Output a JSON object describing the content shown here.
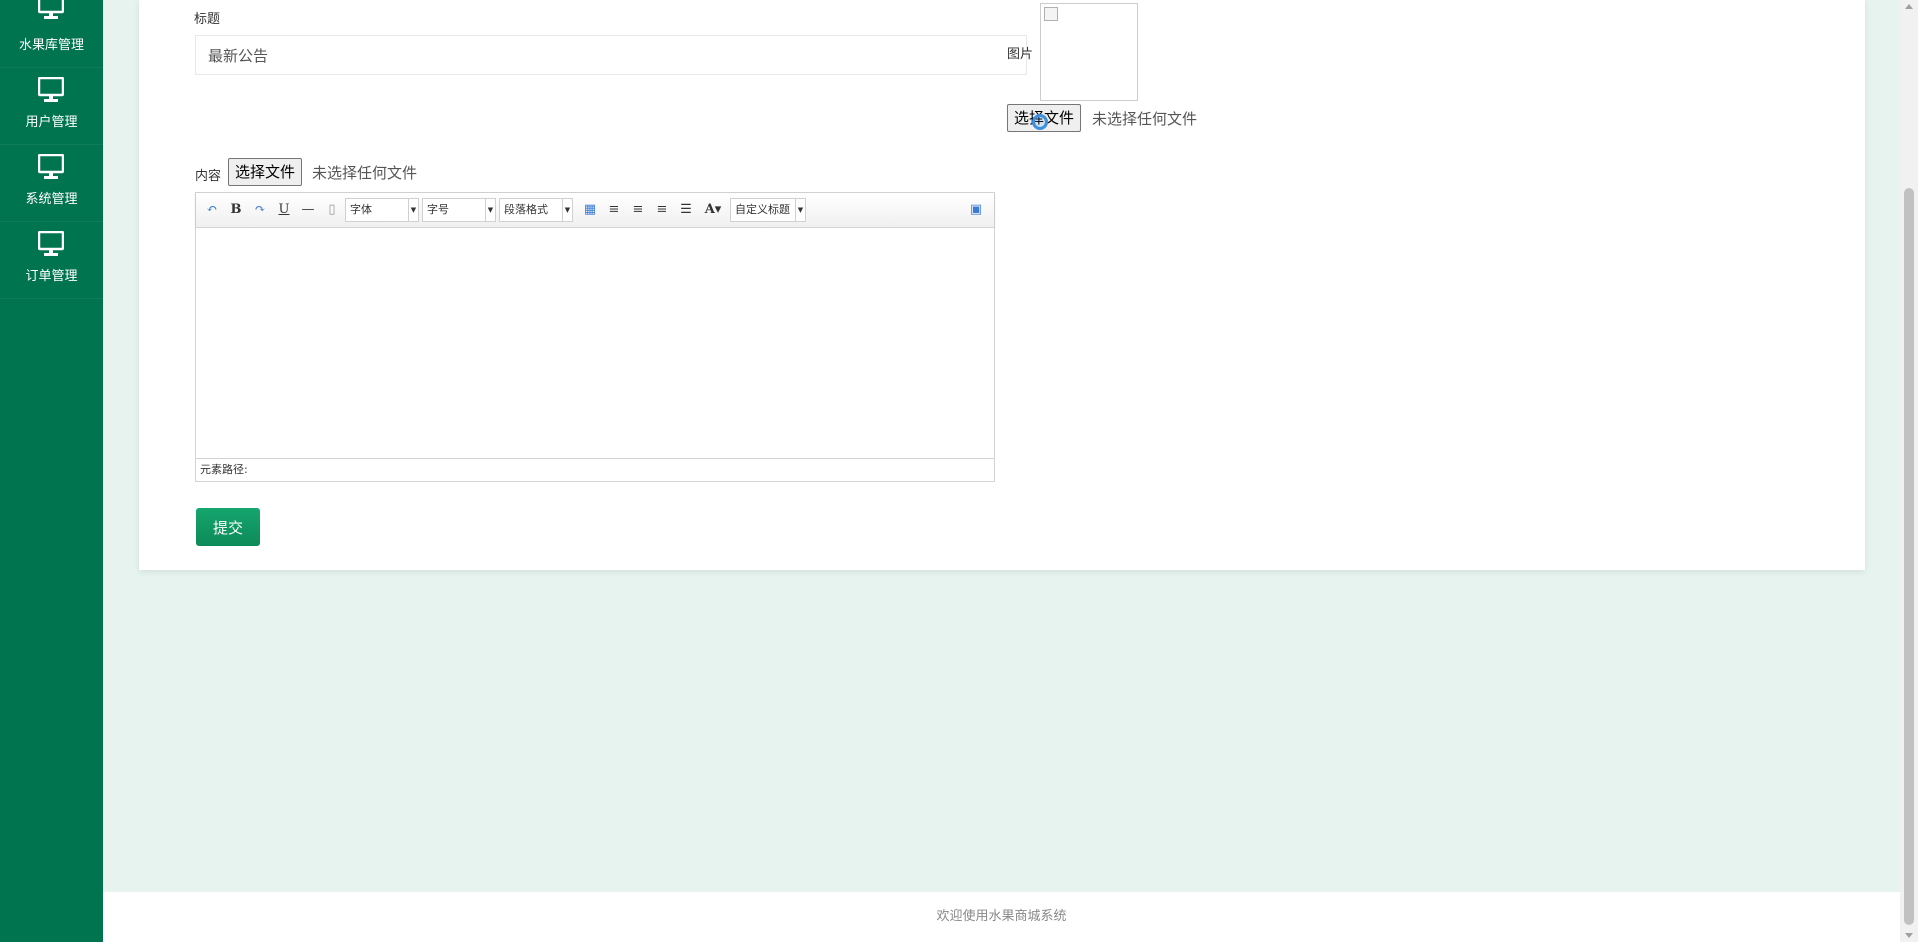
{
  "sidebar": {
    "items": [
      {
        "label": "水果库管理",
        "icon": "monitor-icon"
      },
      {
        "label": "用户管理",
        "icon": "monitor-icon"
      },
      {
        "label": "系统管理",
        "icon": "monitor-icon"
      },
      {
        "label": "订单管理",
        "icon": "monitor-icon"
      }
    ]
  },
  "form": {
    "title_label": "标题",
    "title_value": "最新公告",
    "image_label": "图片",
    "image_file_button": "选择文件",
    "image_file_status": "未选择任何文件",
    "content_label": "内容",
    "content_file_button": "选择文件",
    "content_file_status": "未选择任何文件",
    "submit_label": "提交"
  },
  "editor": {
    "font_family": "字体",
    "font_size": "字号",
    "paragraph": "段落格式",
    "custom_title": "自定义标题",
    "element_path_label": "元素路径:"
  },
  "footer": {
    "text": "欢迎使用水果商城系统"
  },
  "colors": {
    "sidebar": "#00734f",
    "accent": "#15a66e",
    "background": "#e6f3ee"
  }
}
